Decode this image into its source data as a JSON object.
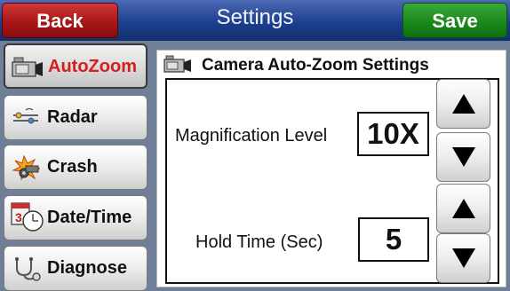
{
  "header": {
    "title": "Settings",
    "back_label": "Back",
    "save_label": "Save"
  },
  "sidebar": {
    "items": [
      {
        "label": "AutoZoom",
        "icon": "camera-icon",
        "active": true
      },
      {
        "label": "Radar",
        "icon": "radar-icon",
        "active": false
      },
      {
        "label": "Crash",
        "icon": "crash-icon",
        "active": false
      },
      {
        "label": "Date/Time",
        "icon": "calendar-clock-icon",
        "active": false
      },
      {
        "label": "Diagnose",
        "icon": "stethoscope-icon",
        "active": false
      }
    ]
  },
  "panel": {
    "title": "Camera Auto-Zoom Settings",
    "magnification": {
      "label": "Magnification Level",
      "value": "10X"
    },
    "hold_time": {
      "label": "Hold Time (Sec)",
      "value": "5"
    }
  },
  "colors": {
    "back_button": "#a81616",
    "save_button": "#1b8a1b",
    "header": "#1c3f8e",
    "active_label": "#d22020",
    "background": "#6f7f98"
  }
}
